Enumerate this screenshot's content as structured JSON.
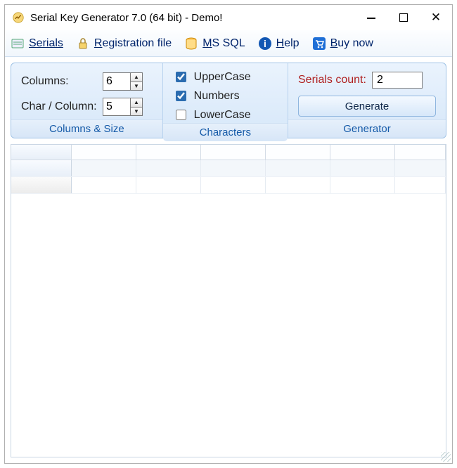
{
  "window": {
    "title": "Serial Key Generator 7.0 (64 bit) - Demo!"
  },
  "menu": {
    "serials": "Serials",
    "registration": "Registration file",
    "mssql": "MS SQL",
    "help": "Help",
    "buy": "Buy now"
  },
  "columns_size": {
    "columns_label": "Columns:",
    "columns_value": "6",
    "char_label": "Char / Column:",
    "char_value": "5",
    "title": "Columns & Size"
  },
  "characters": {
    "upper": "UpperCase",
    "upper_checked": true,
    "numbers": "Numbers",
    "numbers_checked": true,
    "lower": "LowerCase",
    "lower_checked": false,
    "title": "Characters"
  },
  "generator": {
    "count_label": "Serials count:",
    "count_value": "2",
    "button": "Generate",
    "title": "Generator"
  }
}
